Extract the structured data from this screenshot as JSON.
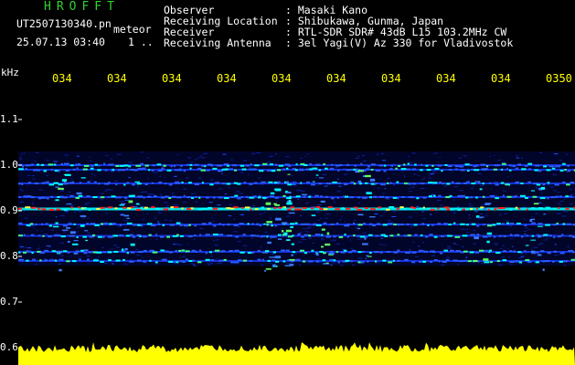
{
  "header": {
    "logo": "HROFFT",
    "filename": "UT2507130340.pn",
    "mode": "meteor",
    "datetime": "25.07.13 03:40",
    "count": "1 ..",
    "fields": [
      {
        "key": "Observer",
        "value": ": Masaki Kano"
      },
      {
        "key": "Receiving Location",
        "value": ": Shibukawa, Gunma, Japan"
      },
      {
        "key": "Receiver",
        "value": ": RTL-SDR SDR# 43dB L15 103.2MHz CW"
      },
      {
        "key": "Receiving Antenna",
        "value": ": 3el Yagi(V) Az 330 for Vladivostok"
      }
    ]
  },
  "chart_data": {
    "type": "heatmap",
    "ylabel": "kHz",
    "y_ticks": [
      "1.1",
      "1.0",
      "0.9",
      "0.8",
      "0.7",
      "0.6"
    ],
    "x_ticks": [
      "034",
      "034",
      "034",
      "034",
      "034",
      "034",
      "034",
      "034",
      "034",
      "0350"
    ],
    "ylim": [
      0.6,
      1.15
    ],
    "signal_bands_khz": [
      1.0,
      0.99,
      0.96,
      0.93,
      0.905,
      0.87,
      0.845,
      0.81,
      0.79
    ],
    "strong_band_khz": 0.905,
    "bursts_khz_range": [
      0.96,
      1.0
    ]
  },
  "colors": {
    "background": "#000000",
    "text": "#ffffff",
    "logo": "#2fd32f",
    "ticks": "#ffff00",
    "signal_weak": "#1a3cff",
    "signal_mid": "#00ffff",
    "signal_strong": "#ff2020",
    "level_bar": "#ffff00"
  }
}
